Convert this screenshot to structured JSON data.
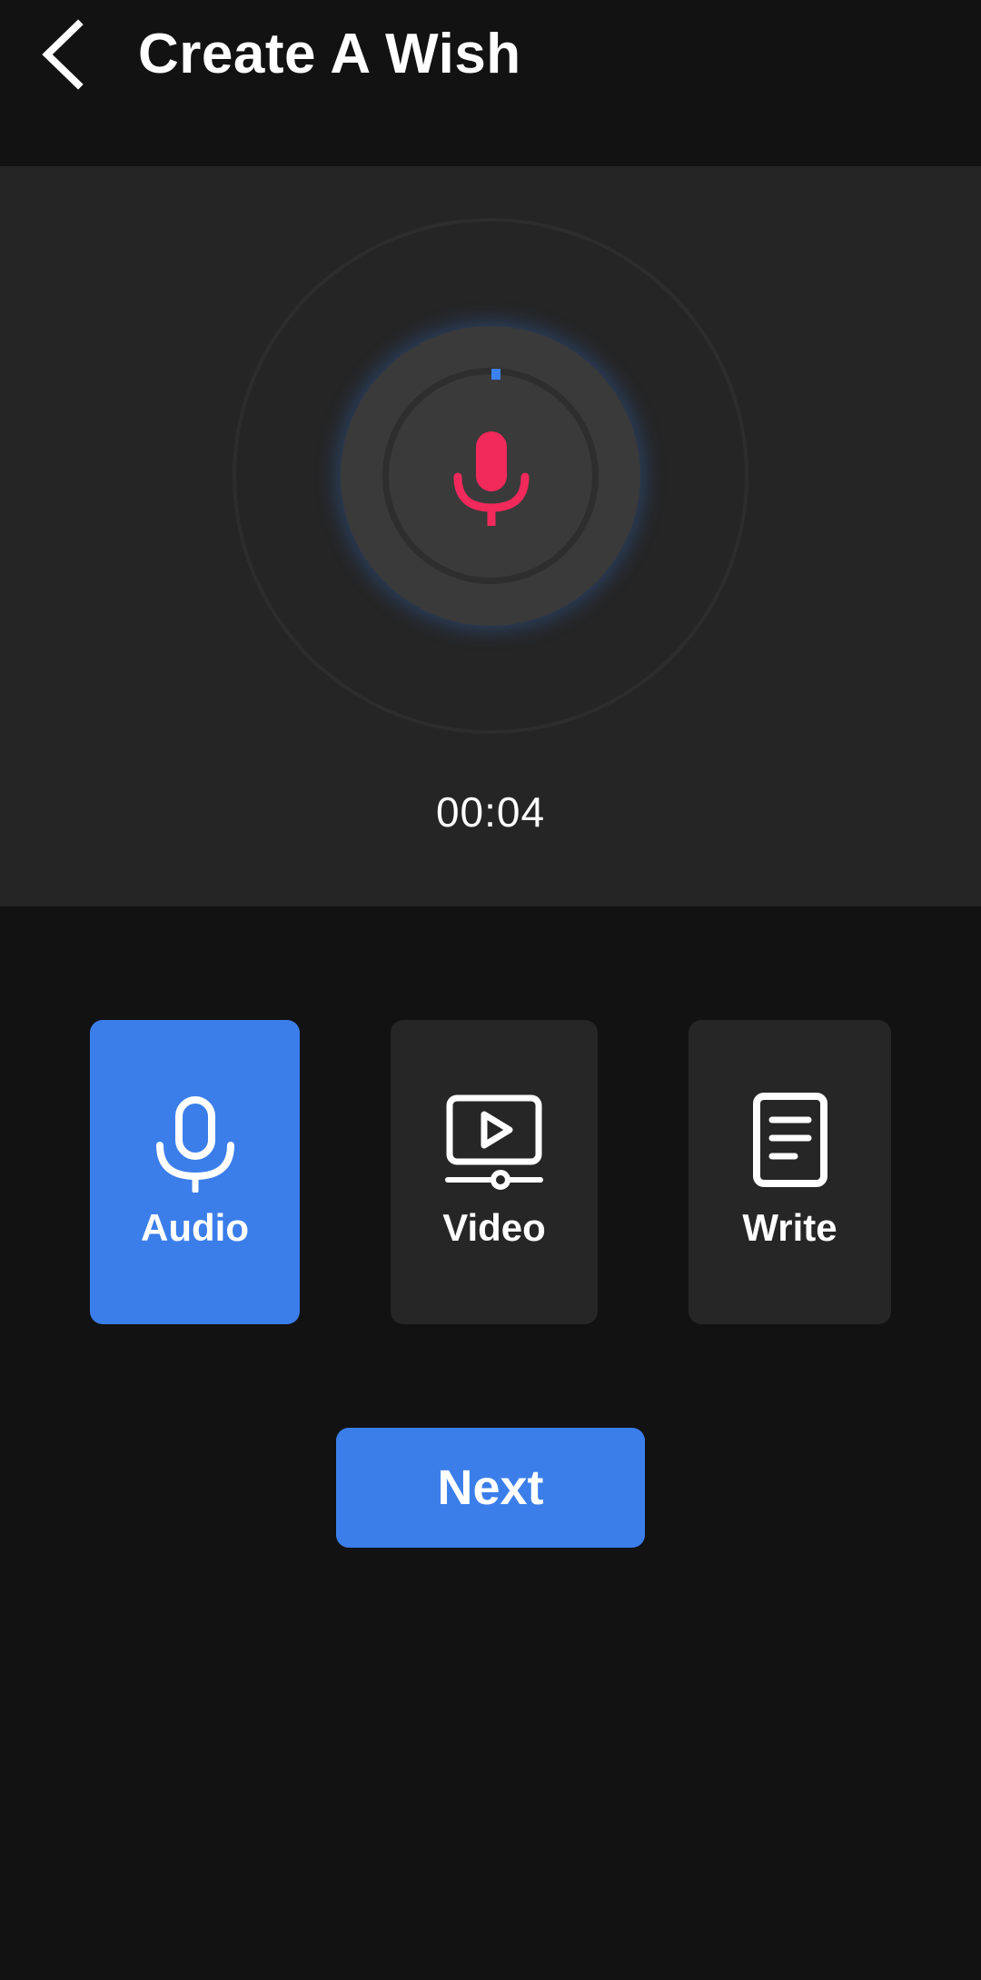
{
  "header": {
    "title": "Create A Wish",
    "back_icon": "chevron-left-icon"
  },
  "recorder": {
    "timer": "00:04",
    "mic_icon": "microphone-icon",
    "mic_color": "#f2295b",
    "progress_color": "#3b82f0"
  },
  "modes": {
    "selected": "Audio",
    "items": [
      {
        "label": "Audio",
        "icon": "microphone-icon",
        "active": true
      },
      {
        "label": "Video",
        "icon": "video-play-icon",
        "active": false
      },
      {
        "label": "Write",
        "icon": "document-icon",
        "active": false
      }
    ]
  },
  "actions": {
    "next_label": "Next"
  },
  "colors": {
    "background": "#121212",
    "panel": "#252525",
    "accent": "#3b7eea",
    "card": "#262626"
  }
}
